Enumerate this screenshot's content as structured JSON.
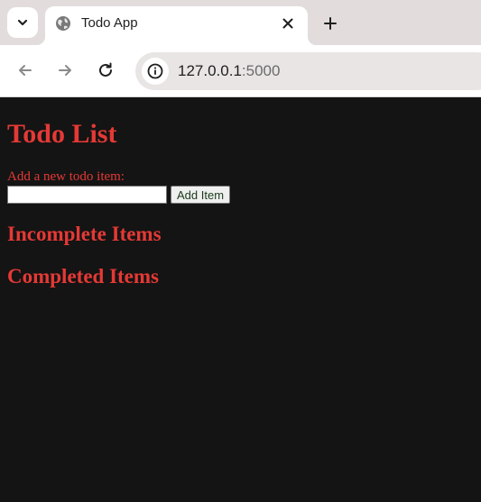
{
  "browser": {
    "tab": {
      "title": "Todo App"
    },
    "address_bar": {
      "host": "127.0.0.1",
      "port": ":5000"
    },
    "icons": {
      "tab_search": "chevron-down-icon",
      "favicon": "globe-icon",
      "close": "close-icon",
      "new_tab": "plus-icon",
      "back": "arrow-left-icon",
      "forward": "arrow-right-icon",
      "reload": "reload-icon",
      "site_info": "info-icon"
    }
  },
  "page": {
    "title": "Todo List",
    "form": {
      "label": "Add a new todo item:",
      "input_value": "",
      "button_label": "Add Item"
    },
    "sections": {
      "incomplete_heading": "Incomplete Items",
      "completed_heading": "Completed Items"
    }
  },
  "colors": {
    "page_background": "#141414",
    "text_accent": "#e53935",
    "tabstrip_background": "#e3dcdc"
  }
}
